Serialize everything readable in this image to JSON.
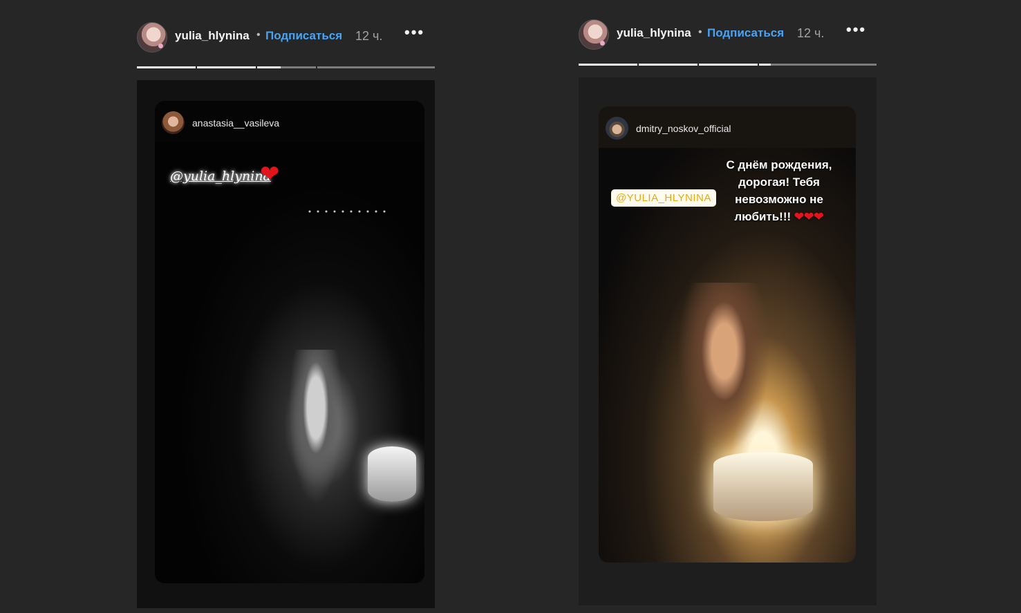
{
  "stories": [
    {
      "header": {
        "username": "yulia_hlynina",
        "separator": "•",
        "follow_label": "Подписаться",
        "time": "12 ч.",
        "more": "•••"
      },
      "progress": [
        1,
        1,
        0.4,
        0,
        0
      ],
      "shared_post": {
        "username": "anastasia__vasileva",
        "mention": "@yulia_hlynina",
        "emoji": "❤"
      }
    },
    {
      "header": {
        "username": "yulia_hlynina",
        "separator": "•",
        "follow_label": "Подписаться",
        "time": "12 ч.",
        "more": "•••"
      },
      "progress": [
        1,
        1,
        1,
        0.2,
        0
      ],
      "shared_post": {
        "username": "dmitry_noskov_official",
        "mention": "@YULIA_HLYNINA",
        "message": "С днём рождения, дорогая! Тебя невозможно не любить!!!",
        "hearts": "❤❤❤"
      }
    }
  ],
  "colors": {
    "background": "#262626",
    "link_blue": "#4aa3f2",
    "heart_red": "#e3141b",
    "mention_yellow": "#e8a80e"
  }
}
